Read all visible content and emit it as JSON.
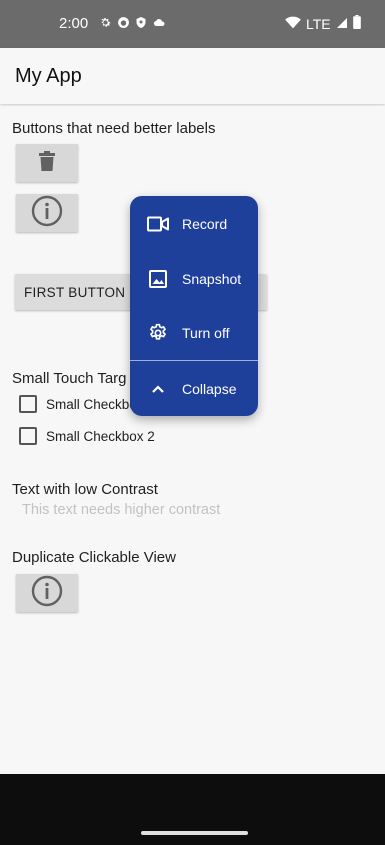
{
  "status_bar": {
    "time": "2:00",
    "network": "LTE",
    "icons_left": [
      "settings-icon",
      "app-icon",
      "shield-icon",
      "cloud-icon"
    ],
    "icons_right": [
      "wifi-icon",
      "signal-icon",
      "battery-icon"
    ]
  },
  "app_bar": {
    "title": "My App"
  },
  "sections": {
    "labels_title": "Buttons that need better labels",
    "first_button_label": "FIRST BUTTON",
    "touch_title": "Small Touch Targ",
    "checkbox_1": "Small Checkbo",
    "checkbox_2": "Small Checkbox 2",
    "contrast_title": "Text with low Contrast",
    "contrast_text": "This text needs higher contrast",
    "duplicate_title": "Duplicate Clickable View"
  },
  "popup_menu": {
    "items": [
      {
        "label": "Record",
        "icon": "video-camera-icon"
      },
      {
        "label": "Snapshot",
        "icon": "image-icon"
      },
      {
        "label": "Turn off",
        "icon": "gear-icon"
      },
      {
        "label": "Collapse",
        "icon": "chevron-up-icon"
      }
    ],
    "background": "#1e3f9a"
  },
  "colors": {
    "status_bar": "#6b6b6b",
    "background": "#f7f7f7",
    "button_gray": "#d8d8d8",
    "low_contrast_text": "#c2c2c2",
    "nav_bar": "#0d0d0d"
  }
}
